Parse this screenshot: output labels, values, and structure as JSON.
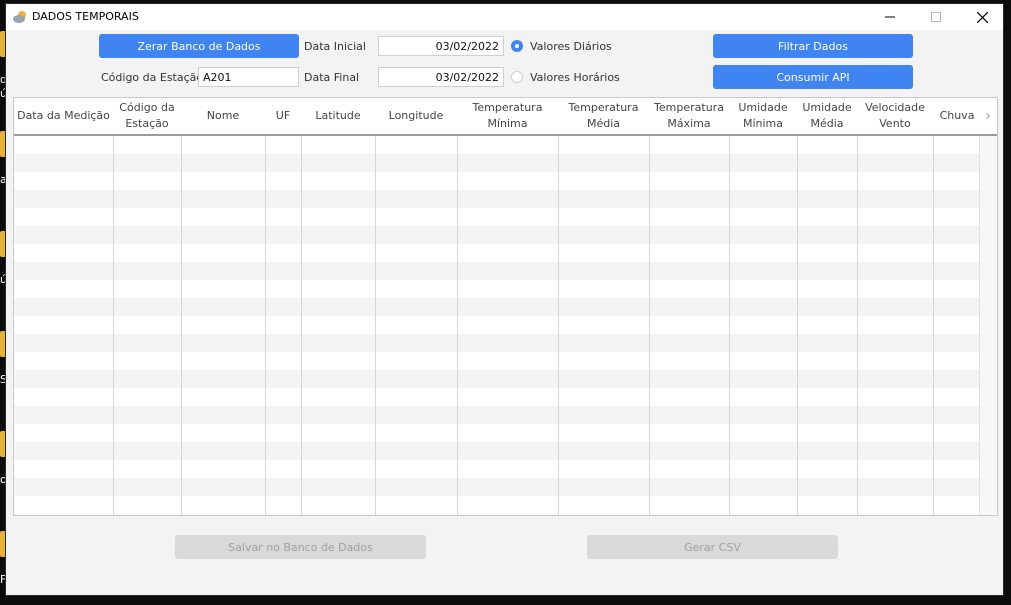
{
  "window": {
    "title": "DADOS TEMPORAIS"
  },
  "desktop": {
    "fragments": [
      "q",
      "ú",
      "a",
      "ú",
      "S",
      "o",
      "Fi"
    ]
  },
  "controls": {
    "reset_db_label": "Zerar Banco de Dados",
    "station_code_label": "Código da Estação",
    "station_code_value": "A201",
    "start_date_label": "Data Inicial",
    "start_date_value": "03/02/2022",
    "end_date_label": "Data Final",
    "end_date_value": "03/02/2022",
    "daily_values_label": "Valores Diários",
    "hourly_values_label": "Valores Horários",
    "daily_selected": true,
    "filter_label": "Filtrar Dados",
    "consume_api_label": "Consumir API"
  },
  "table": {
    "columns": [
      "Data da Medição",
      "Código da\nEstação",
      "Nome",
      "UF",
      "Latitude",
      "Longitude",
      "Temperatura\nMínima",
      "Temperatura\nMédia",
      "Temperatura\nMáxima",
      "Umidade\nMínima",
      "Umidade\nMédia",
      "Velocidade\nVento",
      "Chuva"
    ],
    "rows": []
  },
  "footer": {
    "save_db_label": "Salvar no Banco de Dados",
    "csv_label": "Gerar CSV"
  },
  "colors": {
    "accent": "#3f84f0",
    "disabled": "#d9d9d9"
  }
}
